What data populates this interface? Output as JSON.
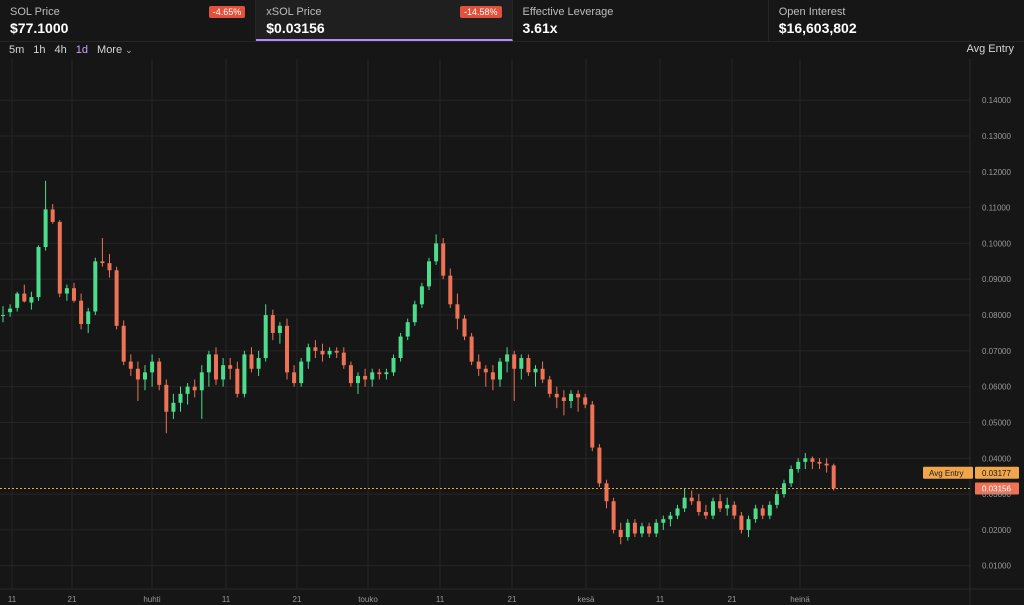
{
  "stats": [
    {
      "label": "SOL Price",
      "value": "$77.1000",
      "badge": "-4.65%"
    },
    {
      "label": "xSOL Price",
      "value": "$0.03156",
      "badge": "-14.58%"
    },
    {
      "label": "Effective Leverage",
      "value": "3.61x"
    },
    {
      "label": "Open Interest",
      "value": "$16,603,802"
    }
  ],
  "toolbar": {
    "timeframes": [
      "5m",
      "1h",
      "4h",
      "1d"
    ],
    "active_timeframe": "1d",
    "more_label": "More",
    "avg_entry_label": "Avg Entry"
  },
  "chart_data": {
    "type": "candlestick",
    "y_ticks": [
      "0.01000",
      "0.02000",
      "0.03000",
      "0.04000",
      "0.05000",
      "0.06000",
      "0.07000",
      "0.08000",
      "0.09000",
      "0.10000",
      "0.11000",
      "0.12000",
      "0.13000",
      "0.14000"
    ],
    "ylim": [
      0.0035,
      0.1515
    ],
    "x_labels": [
      "11",
      "21",
      "huhti",
      "11",
      "21",
      "touko",
      "11",
      "21",
      "kesä",
      "11",
      "21",
      "heinä"
    ],
    "current_price": 0.03156,
    "current_price_label": "0.03156",
    "avg_entry": {
      "label": "Avg Entry",
      "value": 0.03177,
      "value_label": "0.03177"
    },
    "colors": {
      "up": "#4cdc8c",
      "down": "#ee7356",
      "avg": "#f0a64a",
      "grid": "#252525"
    },
    "candles": [
      [
        0.08,
        0.0825,
        0.078,
        0.08
      ],
      [
        0.0808,
        0.083,
        0.0795,
        0.0818
      ],
      [
        0.082,
        0.0865,
        0.081,
        0.086
      ],
      [
        0.086,
        0.0885,
        0.0835,
        0.0838
      ],
      [
        0.0835,
        0.0865,
        0.0815,
        0.085
      ],
      [
        0.085,
        0.0995,
        0.084,
        0.099
      ],
      [
        0.099,
        0.1175,
        0.098,
        0.1095
      ],
      [
        0.1095,
        0.111,
        0.1055,
        0.106
      ],
      [
        0.106,
        0.1065,
        0.085,
        0.086
      ],
      [
        0.086,
        0.0885,
        0.084,
        0.0875
      ],
      [
        0.0875,
        0.089,
        0.0835,
        0.084
      ],
      [
        0.084,
        0.086,
        0.076,
        0.0775
      ],
      [
        0.0775,
        0.082,
        0.075,
        0.081
      ],
      [
        0.081,
        0.096,
        0.08,
        0.095
      ],
      [
        0.095,
        0.1015,
        0.0935,
        0.0945
      ],
      [
        0.0945,
        0.097,
        0.0905,
        0.0925
      ],
      [
        0.0925,
        0.0935,
        0.076,
        0.077
      ],
      [
        0.077,
        0.0785,
        0.066,
        0.067
      ],
      [
        0.067,
        0.069,
        0.063,
        0.065
      ],
      [
        0.065,
        0.067,
        0.056,
        0.062
      ],
      [
        0.062,
        0.066,
        0.059,
        0.064
      ],
      [
        0.064,
        0.069,
        0.06,
        0.067
      ],
      [
        0.067,
        0.068,
        0.059,
        0.0605
      ],
      [
        0.0605,
        0.062,
        0.047,
        0.053
      ],
      [
        0.053,
        0.058,
        0.051,
        0.0555
      ],
      [
        0.0555,
        0.06,
        0.053,
        0.058
      ],
      [
        0.058,
        0.061,
        0.055,
        0.06
      ],
      [
        0.06,
        0.062,
        0.057,
        0.059
      ],
      [
        0.059,
        0.066,
        0.051,
        0.064
      ],
      [
        0.064,
        0.07,
        0.06,
        0.069
      ],
      [
        0.069,
        0.071,
        0.0605,
        0.062
      ],
      [
        0.062,
        0.068,
        0.06,
        0.066
      ],
      [
        0.066,
        0.068,
        0.062,
        0.065
      ],
      [
        0.065,
        0.067,
        0.057,
        0.058
      ],
      [
        0.058,
        0.07,
        0.057,
        0.069
      ],
      [
        0.069,
        0.071,
        0.064,
        0.065
      ],
      [
        0.065,
        0.07,
        0.063,
        0.068
      ],
      [
        0.068,
        0.083,
        0.067,
        0.08
      ],
      [
        0.08,
        0.0815,
        0.073,
        0.075
      ],
      [
        0.075,
        0.078,
        0.072,
        0.077
      ],
      [
        0.077,
        0.079,
        0.062,
        0.064
      ],
      [
        0.064,
        0.066,
        0.06,
        0.061
      ],
      [
        0.061,
        0.068,
        0.06,
        0.067
      ],
      [
        0.067,
        0.072,
        0.065,
        0.071
      ],
      [
        0.071,
        0.073,
        0.068,
        0.07
      ],
      [
        0.07,
        0.072,
        0.067,
        0.069
      ],
      [
        0.069,
        0.071,
        0.068,
        0.07
      ],
      [
        0.07,
        0.071,
        0.068,
        0.0695
      ],
      [
        0.0695,
        0.071,
        0.065,
        0.066
      ],
      [
        0.066,
        0.067,
        0.06,
        0.061
      ],
      [
        0.061,
        0.064,
        0.058,
        0.063
      ],
      [
        0.063,
        0.065,
        0.06,
        0.062
      ],
      [
        0.062,
        0.065,
        0.06,
        0.064
      ],
      [
        0.064,
        0.065,
        0.062,
        0.0635
      ],
      [
        0.0635,
        0.065,
        0.062,
        0.064
      ],
      [
        0.064,
        0.069,
        0.063,
        0.068
      ],
      [
        0.068,
        0.075,
        0.067,
        0.074
      ],
      [
        0.074,
        0.079,
        0.073,
        0.078
      ],
      [
        0.078,
        0.084,
        0.077,
        0.083
      ],
      [
        0.083,
        0.089,
        0.082,
        0.088
      ],
      [
        0.088,
        0.096,
        0.087,
        0.095
      ],
      [
        0.095,
        0.1025,
        0.094,
        0.1
      ],
      [
        0.1,
        0.1015,
        0.09,
        0.091
      ],
      [
        0.091,
        0.093,
        0.082,
        0.083
      ],
      [
        0.083,
        0.086,
        0.076,
        0.079
      ],
      [
        0.079,
        0.08,
        0.073,
        0.074
      ],
      [
        0.074,
        0.075,
        0.066,
        0.067
      ],
      [
        0.067,
        0.069,
        0.063,
        0.065
      ],
      [
        0.065,
        0.066,
        0.06,
        0.064
      ],
      [
        0.064,
        0.066,
        0.059,
        0.062
      ],
      [
        0.062,
        0.068,
        0.06,
        0.067
      ],
      [
        0.067,
        0.071,
        0.064,
        0.069
      ],
      [
        0.069,
        0.07,
        0.056,
        0.065
      ],
      [
        0.065,
        0.069,
        0.062,
        0.068
      ],
      [
        0.068,
        0.069,
        0.063,
        0.064
      ],
      [
        0.064,
        0.066,
        0.06,
        0.065
      ],
      [
        0.065,
        0.067,
        0.061,
        0.062
      ],
      [
        0.062,
        0.063,
        0.057,
        0.058
      ],
      [
        0.058,
        0.06,
        0.054,
        0.057
      ],
      [
        0.057,
        0.059,
        0.052,
        0.056
      ],
      [
        0.056,
        0.059,
        0.054,
        0.058
      ],
      [
        0.058,
        0.059,
        0.053,
        0.057
      ],
      [
        0.057,
        0.058,
        0.054,
        0.055
      ],
      [
        0.055,
        0.056,
        0.042,
        0.043
      ],
      [
        0.043,
        0.044,
        0.032,
        0.033
      ],
      [
        0.033,
        0.034,
        0.026,
        0.028
      ],
      [
        0.028,
        0.029,
        0.019,
        0.02
      ],
      [
        0.02,
        0.022,
        0.016,
        0.018
      ],
      [
        0.018,
        0.023,
        0.017,
        0.022
      ],
      [
        0.022,
        0.023,
        0.018,
        0.019
      ],
      [
        0.019,
        0.022,
        0.018,
        0.021
      ],
      [
        0.021,
        0.022,
        0.018,
        0.019
      ],
      [
        0.019,
        0.023,
        0.018,
        0.022
      ],
      [
        0.022,
        0.024,
        0.02,
        0.023
      ],
      [
        0.023,
        0.025,
        0.021,
        0.024
      ],
      [
        0.024,
        0.027,
        0.023,
        0.026
      ],
      [
        0.026,
        0.0315,
        0.025,
        0.029
      ],
      [
        0.029,
        0.031,
        0.027,
        0.028
      ],
      [
        0.028,
        0.03,
        0.024,
        0.025
      ],
      [
        0.025,
        0.027,
        0.023,
        0.024
      ],
      [
        0.024,
        0.029,
        0.023,
        0.028
      ],
      [
        0.028,
        0.03,
        0.025,
        0.026
      ],
      [
        0.026,
        0.029,
        0.024,
        0.027
      ],
      [
        0.027,
        0.028,
        0.023,
        0.024
      ],
      [
        0.024,
        0.025,
        0.019,
        0.02
      ],
      [
        0.02,
        0.024,
        0.018,
        0.023
      ],
      [
        0.023,
        0.027,
        0.022,
        0.026
      ],
      [
        0.026,
        0.027,
        0.023,
        0.024
      ],
      [
        0.024,
        0.028,
        0.023,
        0.027
      ],
      [
        0.027,
        0.031,
        0.026,
        0.03
      ],
      [
        0.03,
        0.034,
        0.029,
        0.033
      ],
      [
        0.033,
        0.038,
        0.032,
        0.037
      ],
      [
        0.037,
        0.04,
        0.036,
        0.039
      ],
      [
        0.039,
        0.0415,
        0.037,
        0.04
      ],
      [
        0.04,
        0.0405,
        0.037,
        0.039
      ],
      [
        0.039,
        0.04,
        0.037,
        0.0385
      ],
      [
        0.0385,
        0.04,
        0.036,
        0.038
      ],
      [
        0.038,
        0.0385,
        0.031,
        0.0316
      ]
    ]
  }
}
